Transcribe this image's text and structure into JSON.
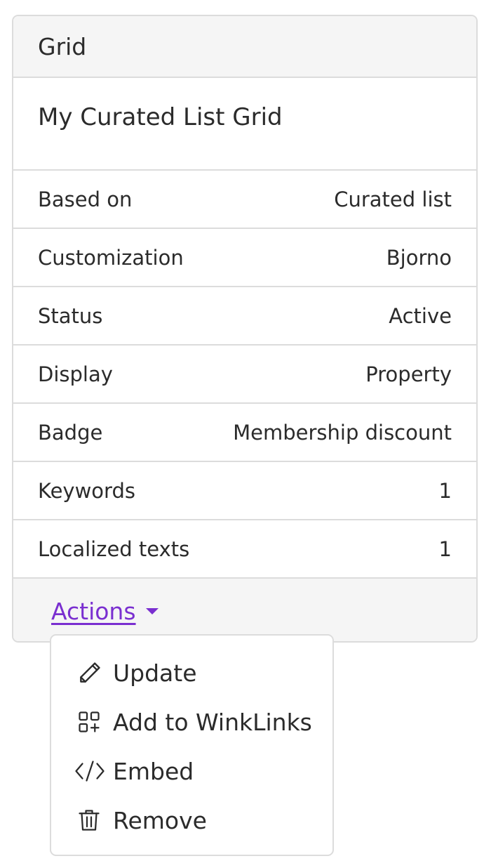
{
  "card": {
    "header": "Grid",
    "title": "My Curated List Grid",
    "rows": [
      {
        "label": "Based on",
        "value": "Curated list"
      },
      {
        "label": "Customization",
        "value": "Bjorno"
      },
      {
        "label": "Status",
        "value": "Active"
      },
      {
        "label": "Display",
        "value": "Property"
      },
      {
        "label": "Badge",
        "value": "Membership discount"
      },
      {
        "label": "Keywords",
        "value": "1"
      },
      {
        "label": "Localized texts",
        "value": "1"
      }
    ],
    "actions_label": "Actions"
  },
  "menu": {
    "items": [
      {
        "label": "Update",
        "icon": "pencil-icon"
      },
      {
        "label": "Add to WinkLinks",
        "icon": "add-widget-icon"
      },
      {
        "label": "Embed",
        "icon": "code-icon"
      },
      {
        "label": "Remove",
        "icon": "trash-icon"
      }
    ]
  },
  "colors": {
    "accent": "#7a2fd0",
    "border": "#dcdcdc",
    "header_bg": "#f5f5f5",
    "text": "#2b2b2b"
  }
}
